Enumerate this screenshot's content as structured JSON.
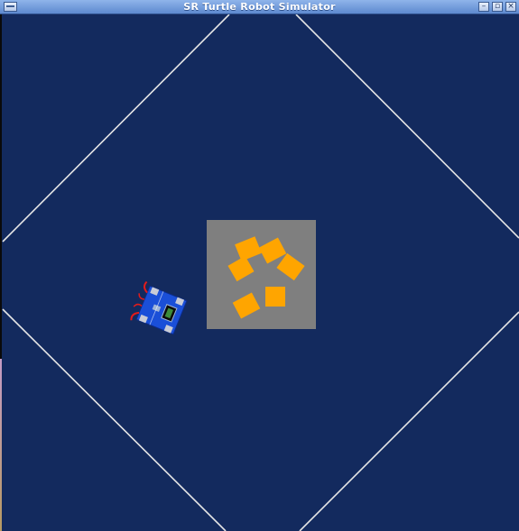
{
  "window": {
    "title": "SR Turtle Robot Simulator",
    "controls": {
      "minimize": "–",
      "maximize": "▫",
      "close": "×"
    }
  },
  "colors": {
    "arena_background": "#132a5e",
    "arena_wall": "#e6e6e6",
    "zone": "#7f7f7f",
    "token": "#ffa500",
    "robot_body": "#1a4fd8"
  },
  "simulation": {
    "token_count": 6,
    "robot": "turtle robot"
  }
}
